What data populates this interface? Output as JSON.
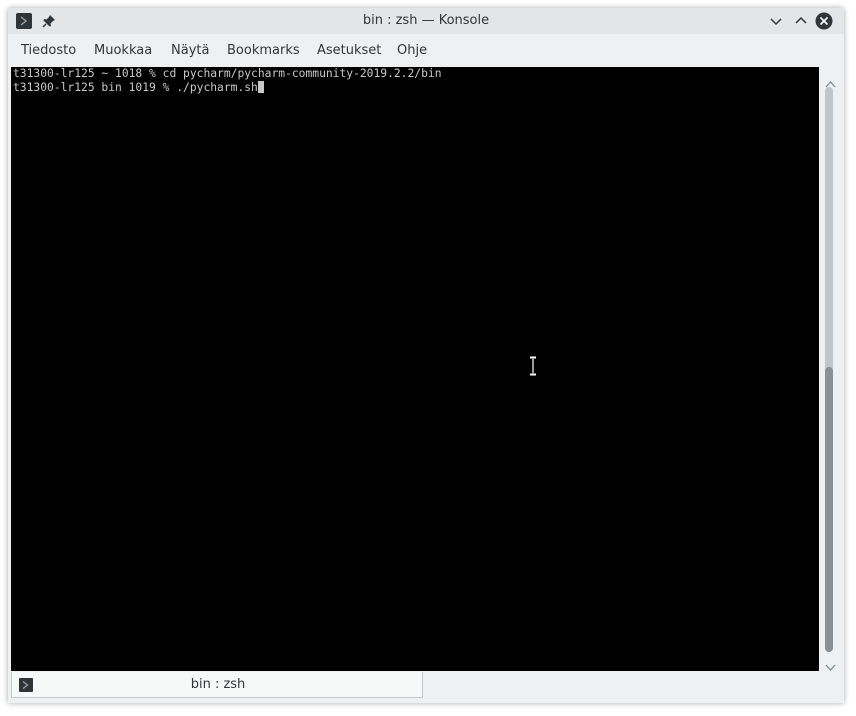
{
  "window": {
    "title": "bin : zsh — Konsole",
    "icon": "terminal-app-icon"
  },
  "titlebar_buttons": {
    "pin": "pin-icon",
    "minimize": "chevron-down-icon",
    "maximize": "chevron-up-icon",
    "close": "close-icon"
  },
  "menu": {
    "items": [
      {
        "label": "Tiedosto"
      },
      {
        "label": "Muokkaa"
      },
      {
        "label": "Näytä"
      },
      {
        "label": "Bookmarks"
      },
      {
        "label": "Asetukset"
      },
      {
        "label": "Ohje"
      }
    ]
  },
  "terminal": {
    "lines": [
      {
        "prompt": "t31300-lr125 ~ 1018 % ",
        "command": "cd pycharm/pycharm-community-2019.2.2/bin"
      },
      {
        "prompt": "t31300-lr125 bin 1019 % ",
        "command": "./pycharm.sh"
      }
    ],
    "background": "#000000",
    "foreground": "#c8c8c8"
  },
  "tabs": [
    {
      "label": "bin : zsh",
      "icon": "terminal-tab-icon",
      "active": true
    }
  ],
  "colors": {
    "window_bg": "#eff0f1",
    "close_button": "#31363b",
    "scroll_thumb": "#8b9095"
  }
}
